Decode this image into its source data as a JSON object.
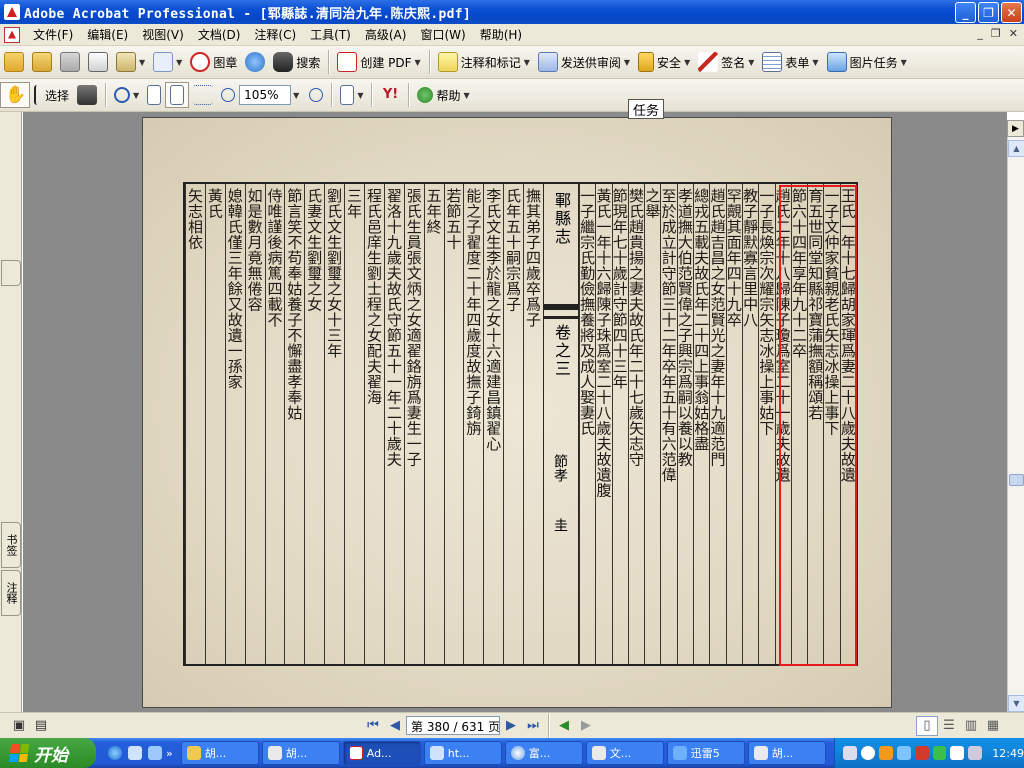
{
  "window": {
    "title": "Adobe Acrobat Professional - [郓縣誌.清同治九年.陈庆熙.pdf]",
    "minimize": "_",
    "restore": "❐",
    "close": "✕"
  },
  "menubar": {
    "items": [
      "文件(F)",
      "编辑(E)",
      "视图(V)",
      "文档(D)",
      "注释(C)",
      "工具(T)",
      "高级(A)",
      "窗口(W)",
      "帮助(H)"
    ],
    "mdi": [
      "_",
      "❐",
      "✕"
    ]
  },
  "toolbar1": {
    "stamp": "图章",
    "search": "搜索",
    "create_pdf": "创建 PDF",
    "comment": "注释和标记",
    "send_review": "发送供审阅",
    "security": "安全",
    "sign": "签名",
    "forms": "表单",
    "image_tasks": "图片任务"
  },
  "toolbar2": {
    "select": "选择",
    "zoom": "105%",
    "help": "帮助"
  },
  "tooltip": "任务",
  "navpane": {
    "tab1": "书签",
    "tab2": "注释"
  },
  "document": {
    "center_title": "鄆縣志",
    "center_juan": "卷之三",
    "center_sub": "節孝",
    "center_page": "圭",
    "columns": [
      "王氏一年十七歸胡家琿爲妻二十八歲夫故遺",
      "一子文仲家貧親老氏矢志冰操上事下",
      "育五世同堂知縣祁寶蒲撫額稱頌若",
      "節六十四年享年九十二卒",
      "趙氏二年十八歸陳子瓊爲室二十一歲夫故遺",
      "一子長煥宗次耀宗矢志冰操上事姑下",
      "教子靜默寡言里中八",
      "罕覿其面年四十九卒",
      "趙氏趙吉昌之女范賢光之妻年十九適范門",
      "總戎五載夫故氏年二十四上事翁姑格盡",
      "孝道撫大伯范賢偉之子興宗爲嗣以養以教",
      "至於成立計守節三十二年卒年五十有六范偉",
      "之舉",
      "樊氏趙貴揚之妻夫故氏年二十七歲矢志守",
      "節現年七十歲計守節四十三年",
      "黃氏一年十六歸陳子珠爲室二十八歲夫故遺腹",
      "一子繼宗氏勤儉撫養將及成人娶妻氏",
      "撫其弟子四歲卒爲子",
      "氏年五十嗣宗爲子",
      "李氏文生李於龍之女十六適建昌鎮翟心",
      "能之子翟度二十年四歲度故撫子錡旃",
      "若節五十",
      "五年終",
      "張氏生員張文炳之女適翟鉻旃爲妻生一子",
      "翟洛十九歲夫故氏守節五十一年二十歲夫",
      "程氏邑庠生劉士程之女配夫翟海",
      "三年",
      "劉氏文生劉璽之女十三年",
      "氏妻文生劉璽之女",
      "節言笑不苟奉姑養子不懈盡孝奉姑",
      "侍唯謹後病篤四載不",
      "如是數月竟無倦容",
      "媳韓氏僅三年餘又故遺一孫家",
      "黃氏",
      "矢志相依"
    ]
  },
  "bottombar": {
    "page_label": "第 380 / 631 页"
  },
  "taskbar": {
    "start": "开始",
    "tasks": [
      "胡...",
      "胡...",
      "Ad...",
      "ht...",
      "富...",
      "文...",
      "迅雷5",
      "胡..."
    ],
    "clock": "12:49"
  },
  "colors": {
    "titlebar": "#0a4fd2",
    "highlight": "#e21b1b",
    "taskbar": "#245edb"
  }
}
